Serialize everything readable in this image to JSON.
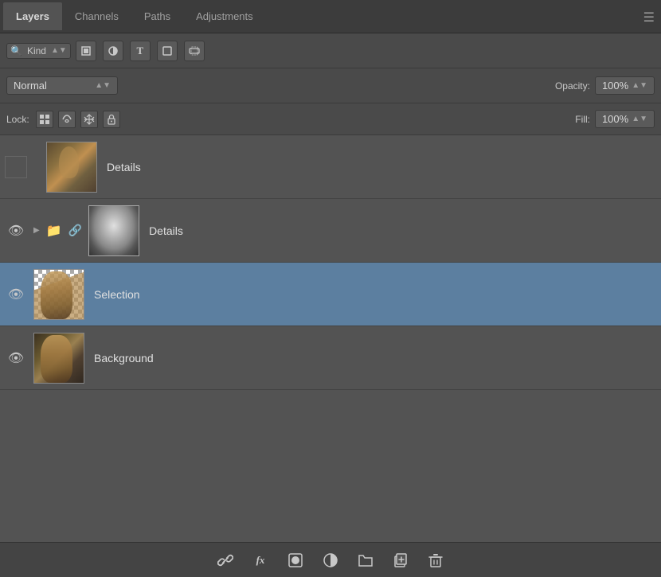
{
  "tabs": [
    {
      "id": "layers",
      "label": "Layers",
      "active": true
    },
    {
      "id": "channels",
      "label": "Channels",
      "active": false
    },
    {
      "id": "paths",
      "label": "Paths",
      "active": false
    },
    {
      "id": "adjustments",
      "label": "Adjustments",
      "active": false
    }
  ],
  "tab_menu_icon": "☰",
  "filter": {
    "type_label": "Kind",
    "icons": [
      "image",
      "text",
      "shape",
      "adjustment",
      "pixel"
    ]
  },
  "blend": {
    "mode": "Normal",
    "opacity_label": "Opacity:",
    "opacity_value": "100%",
    "fill_label": "Fill:",
    "fill_value": "100%"
  },
  "lock": {
    "label": "Lock:",
    "icons": [
      "grid",
      "brush",
      "move",
      "lock"
    ]
  },
  "layers": [
    {
      "id": "details-group",
      "name": "Details",
      "visible": false,
      "type": "regular",
      "selected": false
    },
    {
      "id": "details-layer",
      "name": "Details",
      "visible": true,
      "type": "group",
      "selected": false
    },
    {
      "id": "selection-layer",
      "name": "Selection",
      "visible": true,
      "type": "transparent",
      "selected": true
    },
    {
      "id": "background-layer",
      "name": "Background",
      "visible": true,
      "type": "regular",
      "selected": false
    }
  ],
  "bottom_bar": {
    "buttons": [
      {
        "id": "link",
        "icon": "🔗",
        "label": "link-layers"
      },
      {
        "id": "fx",
        "icon": "fx",
        "label": "add-layer-style"
      },
      {
        "id": "mask",
        "icon": "⬜",
        "label": "add-mask"
      },
      {
        "id": "adjustment",
        "icon": "◑",
        "label": "new-adjustment"
      },
      {
        "id": "group",
        "icon": "📁",
        "label": "new-group"
      },
      {
        "id": "new",
        "icon": "📄",
        "label": "new-layer"
      },
      {
        "id": "delete",
        "icon": "🗑",
        "label": "delete-layer"
      }
    ]
  }
}
